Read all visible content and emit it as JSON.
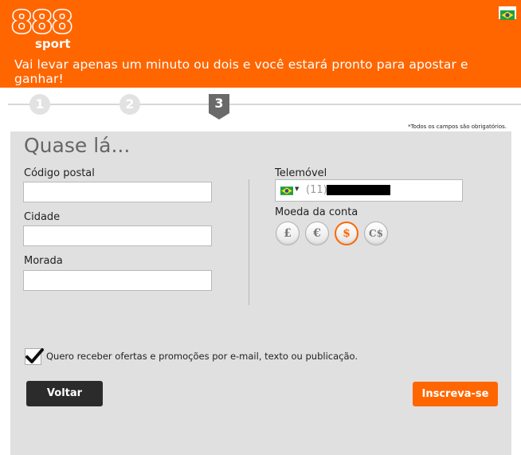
{
  "header": {
    "logo_number": "888",
    "logo_sub": "sport",
    "tagline": "Vai levar apenas um minuto ou dois e você estará pronto para apostar e ganhar!",
    "flag_icon": "brazil-flag-icon"
  },
  "steps": {
    "items": [
      "1",
      "2",
      "3"
    ],
    "current": 3
  },
  "required_note": "*Todos os campos são obrigatórios.",
  "form": {
    "title": "Quase lá...",
    "postal_code_label": "Código postal",
    "postal_code_value": "",
    "city_label": "Cidade",
    "city_value": "",
    "address_label": "Morada",
    "address_value": "",
    "phone_label": "Telemóvel",
    "phone_prefix": "(11)",
    "phone_country_icon": "brazil-flag-icon",
    "currency_label": "Moeda da conta",
    "currencies": [
      "£",
      "€",
      "$",
      "C$"
    ],
    "selected_currency": "$",
    "offers_checkbox_label": "Quero receber ofertas e promoções por e-mail, texto ou publicação.",
    "offers_checked": true,
    "back_button": "Voltar",
    "signup_button": "Inscreva-se"
  },
  "colors": {
    "brand_orange": "#ff6600",
    "panel_grey": "#e0e0e0",
    "back_button_bg": "#2b2b2b"
  }
}
